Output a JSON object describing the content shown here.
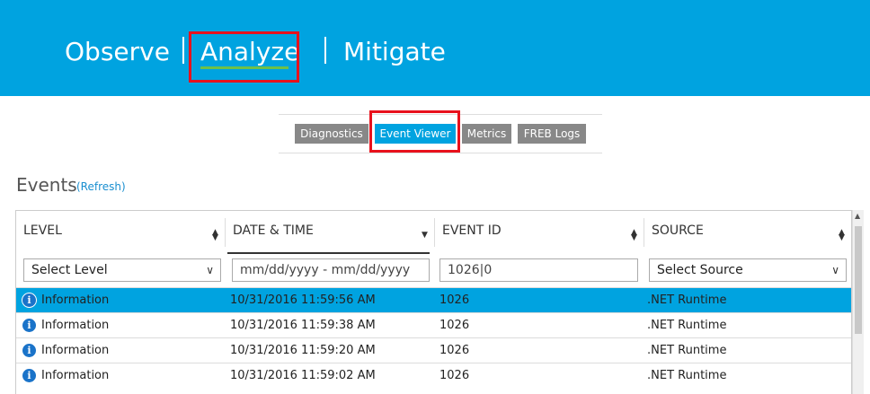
{
  "nav": {
    "items": [
      {
        "label": "Observe"
      },
      {
        "label": "Analyze"
      },
      {
        "label": "Mitigate"
      }
    ]
  },
  "subnav": {
    "tabs": [
      {
        "label": "Diagnostics"
      },
      {
        "label": "Event Viewer"
      },
      {
        "label": "Metrics"
      },
      {
        "label": "FREB Logs"
      }
    ]
  },
  "events": {
    "title": "Events",
    "refresh_label": "(Refresh)"
  },
  "grid": {
    "columns": [
      {
        "label": "LEVEL"
      },
      {
        "label": "DATE & TIME"
      },
      {
        "label": "EVENT ID"
      },
      {
        "label": "SOURCE"
      }
    ],
    "filters": {
      "level": "Select Level",
      "date_placeholder": "mm/dd/yyyy - mm/dd/yyyy",
      "event_id": "1026|0",
      "source": "Select Source"
    },
    "rows": [
      {
        "level": "Information",
        "datetime": "10/31/2016 11:59:56 AM",
        "event_id": "1026",
        "source": ".NET Runtime"
      },
      {
        "level": "Information",
        "datetime": "10/31/2016 11:59:38 AM",
        "event_id": "1026",
        "source": ".NET Runtime"
      },
      {
        "level": "Information",
        "datetime": "10/31/2016 11:59:20 AM",
        "event_id": "1026",
        "source": ".NET Runtime"
      },
      {
        "level": "Information",
        "datetime": "10/31/2016 11:59:02 AM",
        "event_id": "1026",
        "source": ".NET Runtime"
      }
    ]
  },
  "colors": {
    "brand": "#00a3e0",
    "highlight": "#e8111c",
    "underline": "#6cc04a",
    "tab_inactive": "#888888"
  }
}
